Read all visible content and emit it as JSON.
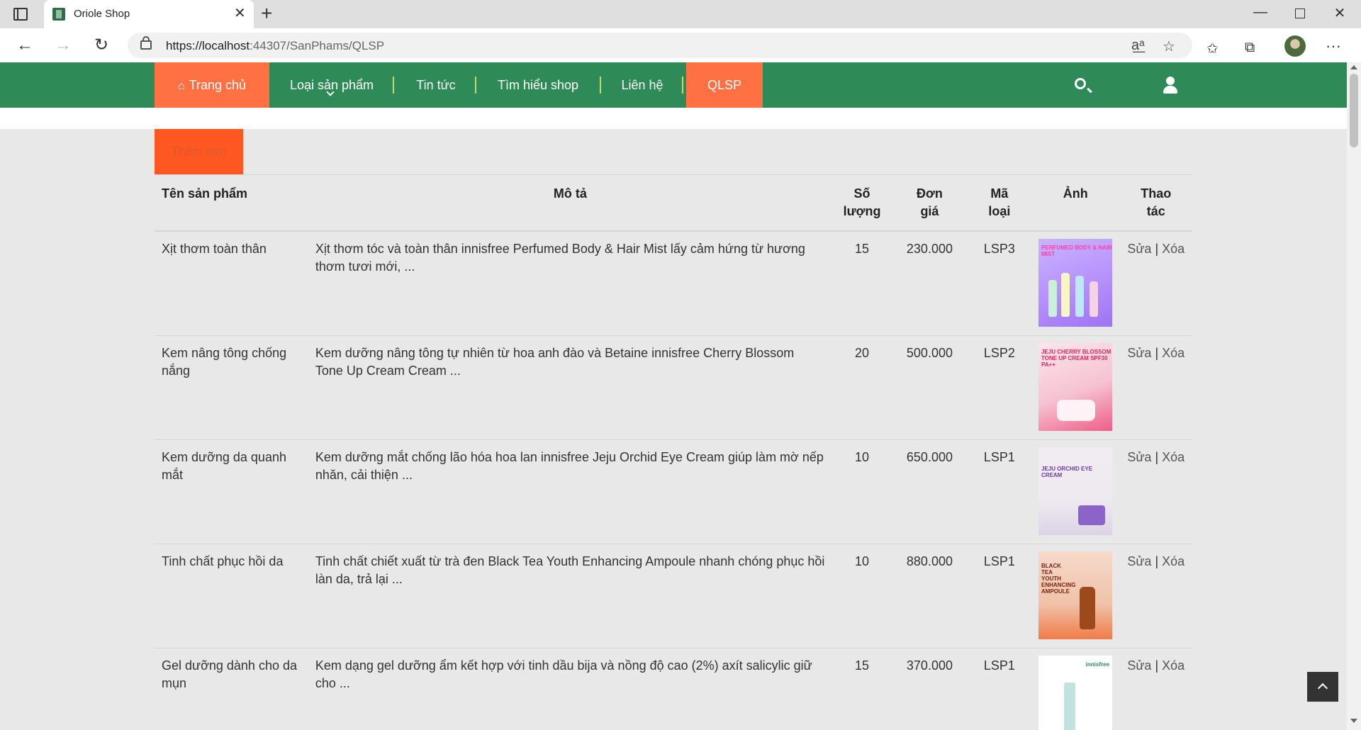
{
  "browser": {
    "tab_title": "Oriole Shop",
    "tab_close": "✕",
    "new_tab": "+",
    "url_host": "https://localhost",
    "url_path": ":44307/SanPhams/QLSP"
  },
  "nav": {
    "home": "Trang chủ",
    "types": "Loại sản phẩm",
    "news": "Tin tức",
    "about": "Tìm hiểu shop",
    "contact": "Liên hệ",
    "qlsp": "QLSP"
  },
  "add_button": "Thêm mới",
  "table": {
    "headers": {
      "name": "Tên sản phẩm",
      "desc": "Mô tả",
      "qty_1": "Số",
      "qty_2": "lượng",
      "price_1": "Đơn",
      "price_2": "giá",
      "code_1": "Mã",
      "code_2": "loại",
      "image": "Ảnh",
      "action_1": "Thao",
      "action_2": "tác"
    },
    "edit_label": "Sửa",
    "action_separator": "|",
    "delete_label": "Xóa",
    "rows": [
      {
        "name": "Xịt thơm toàn thân",
        "desc": "Xịt thơm tóc và toàn thân innisfree Perfumed Body & Hair Mist lấy cảm hứng từ hương thơm tươi mới, ...",
        "qty": "15",
        "price": "230.000",
        "code": "LSP3",
        "image_text": "PERFUMED BODY & HAIR MIST"
      },
      {
        "name": "Kem nâng tông chống nắng",
        "desc": "Kem dưỡng nâng tông tự nhiên từ hoa anh đào và Betaine innisfree Cherry Blossom Tone Up Cream Cream ...",
        "qty": "20",
        "price": "500.000",
        "code": "LSP2",
        "image_text": "JEJU CHERRY BLOSSOM TONE UP CREAM SPF30 PA++"
      },
      {
        "name": "Kem dưỡng da quanh mắt",
        "desc": "Kem dưỡng mắt chống lão hóa hoa lan innisfree Jeju Orchid Eye Cream giúp làm mờ nếp nhăn, cải thiện ...",
        "qty": "10",
        "price": "650.000",
        "code": "LSP1",
        "image_text": "JEJU ORCHID EYE CREAM"
      },
      {
        "name": "Tinh chất phục hồi da",
        "desc": "Tinh chất chiết xuất từ trà đen Black Tea Youth Enhancing Ampoule nhanh chóng phục hồi làn da, trả lại ...",
        "qty": "10",
        "price": "880.000",
        "code": "LSP1",
        "image_text": "BLACK TEA YOUTH ENHANCING AMPOULE"
      },
      {
        "name": "Gel dưỡng dành cho da mụn",
        "desc": "Kem dạng gel dưỡng ẩm kết hợp với tinh dầu bija và nồng độ cao (2%) axít salicylic giữ cho ...",
        "qty": "15",
        "price": "370.000",
        "code": "LSP1",
        "image_text": "innisfree"
      }
    ]
  }
}
